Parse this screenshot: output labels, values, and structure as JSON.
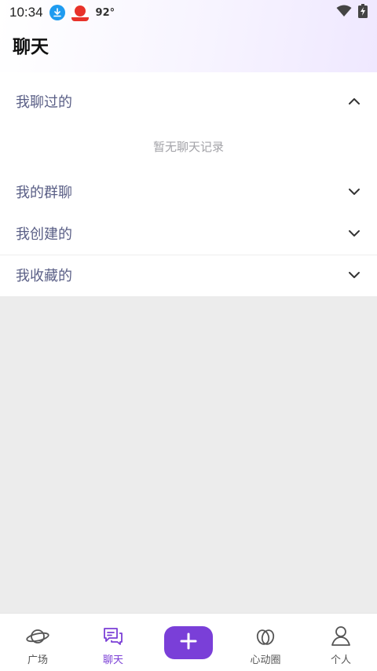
{
  "status_bar": {
    "time": "10:34",
    "temperature": "92°",
    "icons": [
      "download-icon",
      "app-notification-icon",
      "wifi-icon",
      "battery-charging-icon"
    ]
  },
  "header": {
    "title": "聊天"
  },
  "sections": {
    "chatted": {
      "label": "我聊过的",
      "expanded": true,
      "empty_text": "暂无聊天记录"
    },
    "groups": {
      "label": "我的群聊",
      "expanded": false
    },
    "created": {
      "label": "我创建的",
      "expanded": false
    },
    "favorites": {
      "label": "我收藏的",
      "expanded": false
    }
  },
  "bottom_nav": {
    "items": [
      {
        "label": "广场",
        "icon": "planet-icon",
        "active": false
      },
      {
        "label": "聊天",
        "icon": "chat-icon",
        "active": true
      },
      {
        "label": "",
        "icon": "plus-icon",
        "active": false
      },
      {
        "label": "心动圈",
        "icon": "heart-circles-icon",
        "active": false
      },
      {
        "label": "个人",
        "icon": "person-icon",
        "active": false
      }
    ]
  },
  "colors": {
    "accent": "#7b3fd6",
    "section_text": "#5a5f86",
    "muted_text": "#a3a3a8",
    "background": "#ececec"
  }
}
